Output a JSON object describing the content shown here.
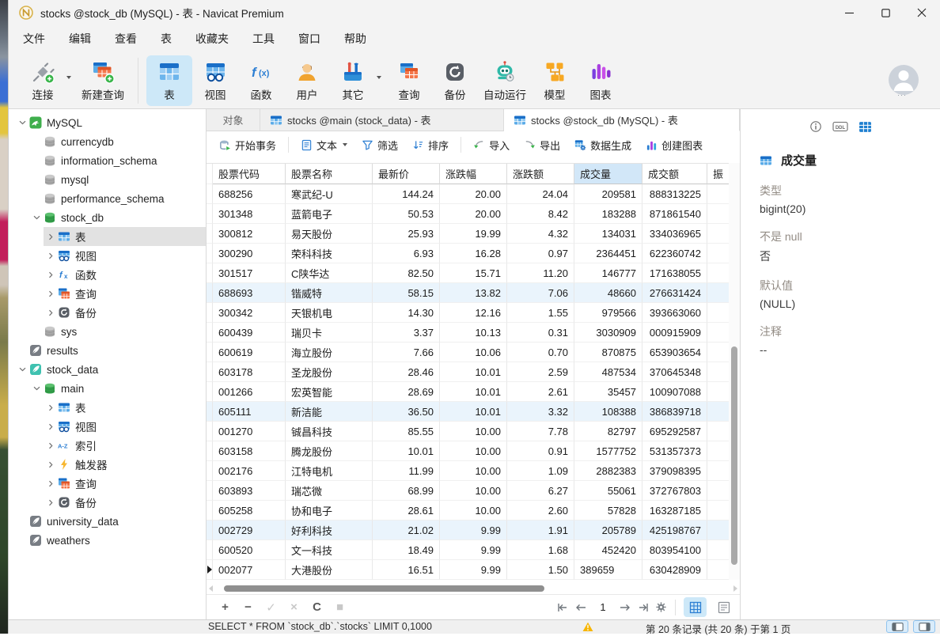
{
  "window": {
    "title": "stocks @stock_db (MySQL) - 表 - Navicat Premium"
  },
  "menu": {
    "items": [
      "文件",
      "编辑",
      "查看",
      "表",
      "收藏夹",
      "工具",
      "窗口",
      "帮助"
    ]
  },
  "toolbar": {
    "items": [
      {
        "label": "连接",
        "icon": "connection",
        "dropdown": true,
        "active": false
      },
      {
        "label": "新建查询",
        "icon": "new-query",
        "dropdown": false,
        "active": false
      },
      {
        "label": "表",
        "icon": "table-lg",
        "dropdown": false,
        "active": true
      },
      {
        "label": "视图",
        "icon": "view-lg",
        "dropdown": false,
        "active": false
      },
      {
        "label": "函数",
        "icon": "function-lg",
        "dropdown": false,
        "active": false
      },
      {
        "label": "用户",
        "icon": "user-lg",
        "dropdown": false,
        "active": false
      },
      {
        "label": "其它",
        "icon": "others-lg",
        "dropdown": true,
        "active": false
      },
      {
        "label": "查询",
        "icon": "query-lg",
        "dropdown": false,
        "active": false
      },
      {
        "label": "备份",
        "icon": "backup-lg",
        "dropdown": false,
        "active": false
      },
      {
        "label": "自动运行",
        "icon": "automation-lg",
        "dropdown": false,
        "active": false
      },
      {
        "label": "模型",
        "icon": "model-lg",
        "dropdown": false,
        "active": false
      },
      {
        "label": "图表",
        "icon": "charts-lg",
        "dropdown": false,
        "active": false
      }
    ]
  },
  "sidebar": {
    "items": [
      {
        "label": "MySQL",
        "icon": "mysql-connection",
        "level": 0,
        "chevron": "expanded",
        "selected": false
      },
      {
        "label": "currencydb",
        "icon": "database-gray",
        "level": 1,
        "chevron": "none",
        "selected": false
      },
      {
        "label": "information_schema",
        "icon": "database-gray",
        "level": 1,
        "chevron": "none",
        "selected": false
      },
      {
        "label": "mysql",
        "icon": "database-gray",
        "level": 1,
        "chevron": "none",
        "selected": false
      },
      {
        "label": "performance_schema",
        "icon": "database-gray",
        "level": 1,
        "chevron": "none",
        "selected": false
      },
      {
        "label": "stock_db",
        "icon": "database-green",
        "level": 1,
        "chevron": "expanded",
        "selected": false
      },
      {
        "label": "表",
        "icon": "table",
        "level": 2,
        "chevron": "collapsed",
        "selected": true
      },
      {
        "label": "视图",
        "icon": "view",
        "level": 2,
        "chevron": "collapsed",
        "selected": false
      },
      {
        "label": "函数",
        "icon": "function",
        "level": 2,
        "chevron": "collapsed",
        "selected": false
      },
      {
        "label": "查询",
        "icon": "query",
        "level": 2,
        "chevron": "collapsed",
        "selected": false
      },
      {
        "label": "备份",
        "icon": "backup",
        "level": 2,
        "chevron": "collapsed",
        "selected": false
      },
      {
        "label": "sys",
        "icon": "database-gray",
        "level": 1,
        "chevron": "none",
        "selected": false
      },
      {
        "label": "results",
        "icon": "sqlite-gray",
        "level": 0,
        "chevron": "none",
        "selected": false
      },
      {
        "label": "stock_data",
        "icon": "sqlite-teal",
        "level": 0,
        "chevron": "expanded",
        "selected": false
      },
      {
        "label": "main",
        "icon": "database-green",
        "level": 1,
        "chevron": "expanded",
        "selected": false
      },
      {
        "label": "表",
        "icon": "table",
        "level": 2,
        "chevron": "collapsed",
        "selected": false
      },
      {
        "label": "视图",
        "icon": "view",
        "level": 2,
        "chevron": "collapsed",
        "selected": false
      },
      {
        "label": "索引",
        "icon": "index-az",
        "level": 2,
        "chevron": "collapsed",
        "selected": false
      },
      {
        "label": "触发器",
        "icon": "trigger",
        "level": 2,
        "chevron": "collapsed",
        "selected": false
      },
      {
        "label": "查询",
        "icon": "query",
        "level": 2,
        "chevron": "collapsed",
        "selected": false
      },
      {
        "label": "备份",
        "icon": "backup",
        "level": 2,
        "chevron": "collapsed",
        "selected": false
      },
      {
        "label": "university_data",
        "icon": "sqlite-gray",
        "level": 0,
        "chevron": "none",
        "selected": false
      },
      {
        "label": "weathers",
        "icon": "sqlite-gray",
        "level": 0,
        "chevron": "none",
        "selected": false
      }
    ]
  },
  "tabs": [
    {
      "label": "对象",
      "icon": false,
      "active": false
    },
    {
      "label": "stocks @main (stock_data) - 表",
      "icon": true,
      "active": false
    },
    {
      "label": "stocks @stock_db (MySQL) - 表",
      "icon": true,
      "active": true
    }
  ],
  "table_toolbar": {
    "items": [
      {
        "label": "开始事务",
        "icon": "transaction",
        "dropdown": false,
        "sep_after": true
      },
      {
        "label": "文本",
        "icon": "text-doc",
        "dropdown": true,
        "sep_after": false
      },
      {
        "label": "筛选",
        "icon": "filter",
        "dropdown": false,
        "sep_after": false
      },
      {
        "label": "排序",
        "icon": "sort",
        "dropdown": false,
        "sep_after": true
      },
      {
        "label": "导入",
        "icon": "import",
        "dropdown": false,
        "sep_after": false
      },
      {
        "label": "导出",
        "icon": "export",
        "dropdown": false,
        "sep_after": false
      },
      {
        "label": "数据生成",
        "icon": "data-generation",
        "dropdown": false,
        "sep_after": false
      },
      {
        "label": "创建图表",
        "icon": "create-chart",
        "dropdown": false,
        "sep_after": false
      }
    ]
  },
  "grid": {
    "columns": [
      {
        "label": "股票代码",
        "align": "left",
        "selected": false
      },
      {
        "label": "股票名称",
        "align": "left",
        "selected": false
      },
      {
        "label": "最新价",
        "align": "right",
        "selected": false
      },
      {
        "label": "涨跌幅",
        "align": "right",
        "selected": false
      },
      {
        "label": "涨跌额",
        "align": "right",
        "selected": false
      },
      {
        "label": "成交量",
        "align": "right",
        "selected": true
      },
      {
        "label": "成交额",
        "align": "right",
        "selected": false
      },
      {
        "label": "振",
        "align": "left",
        "selected": false
      }
    ],
    "rows": [
      [
        "688256",
        "寒武纪-U",
        "144.24",
        "20.00",
        "24.04",
        "209581",
        "888313225",
        ""
      ],
      [
        "301348",
        "蓝箭电子",
        "50.53",
        "20.00",
        "8.42",
        "183288",
        "871861540",
        ""
      ],
      [
        "300812",
        "易天股份",
        "25.93",
        "19.99",
        "4.32",
        "134031",
        "334036965",
        ""
      ],
      [
        "300290",
        "荣科科技",
        "6.93",
        "16.28",
        "0.97",
        "2364451",
        "622360742",
        ""
      ],
      [
        "301517",
        "C陕华达",
        "82.50",
        "15.71",
        "11.20",
        "146777",
        "171638055",
        ""
      ],
      [
        "688693",
        "锴威特",
        "58.15",
        "13.82",
        "7.06",
        "48660",
        "276631424",
        ""
      ],
      [
        "300342",
        "天银机电",
        "14.30",
        "12.16",
        "1.55",
        "979566",
        "393663060",
        ""
      ],
      [
        "600439",
        "瑞贝卡",
        "3.37",
        "10.13",
        "0.31",
        "3030909",
        "000915909",
        ""
      ],
      [
        "600619",
        "海立股份",
        "7.66",
        "10.06",
        "0.70",
        "870875",
        "653903654",
        ""
      ],
      [
        "603178",
        "圣龙股份",
        "28.46",
        "10.01",
        "2.59",
        "487534",
        "370645348",
        ""
      ],
      [
        "001266",
        "宏英智能",
        "28.69",
        "10.01",
        "2.61",
        "35457",
        "100907088",
        ""
      ],
      [
        "605111",
        "新洁能",
        "36.50",
        "10.01",
        "3.32",
        "108388",
        "386839718",
        ""
      ],
      [
        "001270",
        "铖昌科技",
        "85.55",
        "10.00",
        "7.78",
        "82797",
        "695292587",
        ""
      ],
      [
        "603158",
        "腾龙股份",
        "10.01",
        "10.00",
        "0.91",
        "1577752",
        "531357373",
        ""
      ],
      [
        "002176",
        "江特电机",
        "11.99",
        "10.00",
        "1.09",
        "2882383",
        "379098395",
        ""
      ],
      [
        "603893",
        "瑞芯微",
        "68.99",
        "10.00",
        "6.27",
        "55061",
        "372767803",
        ""
      ],
      [
        "605258",
        "协和电子",
        "28.61",
        "10.00",
        "2.60",
        "57828",
        "163287185",
        ""
      ],
      [
        "002729",
        "好利科技",
        "21.02",
        "9.99",
        "1.91",
        "205789",
        "425198767",
        ""
      ],
      [
        "600520",
        "文一科技",
        "18.49",
        "9.99",
        "1.68",
        "452420",
        "803954100",
        ""
      ],
      [
        "002077",
        "大港股份",
        "16.51",
        "9.99",
        "1.50",
        "389659",
        "630428909",
        ""
      ]
    ],
    "highlighted_rows": [
      5,
      11,
      17
    ],
    "current_row": 19,
    "selected_cell": {
      "row": 19,
      "col": 5
    }
  },
  "record_toolbar": {
    "buttons": [
      {
        "name": "add-record-button",
        "glyph": "+",
        "enabled": true
      },
      {
        "name": "delete-record-button",
        "glyph": "−",
        "enabled": true
      },
      {
        "name": "apply-changes-button",
        "glyph": "✓",
        "enabled": false
      },
      {
        "name": "discard-changes-button",
        "glyph": "×",
        "enabled": false
      },
      {
        "name": "refresh-button",
        "glyph": "C",
        "enabled": true
      },
      {
        "name": "stop-button",
        "glyph": "■",
        "enabled": false
      }
    ],
    "page": "1"
  },
  "right_panel": {
    "title": "成交量",
    "sections": [
      {
        "label": "类型",
        "value": "bigint(20)"
      },
      {
        "label": "不是 null",
        "value": "否"
      },
      {
        "label": "默认值",
        "value": "(NULL)"
      },
      {
        "label": "注释",
        "value": "--"
      }
    ]
  },
  "status_bar": {
    "sql": "SELECT * FROM `stock_db`.`stocks` LIMIT 0,1000",
    "record_info": "第 20 条记录 (共 20 条) 于第 1 页"
  },
  "colors": {
    "accent": "#1e7fd0",
    "selection": "#cde8f8",
    "header_selected": "#d2e7f8",
    "row_highlight": "#eaf4fc"
  }
}
